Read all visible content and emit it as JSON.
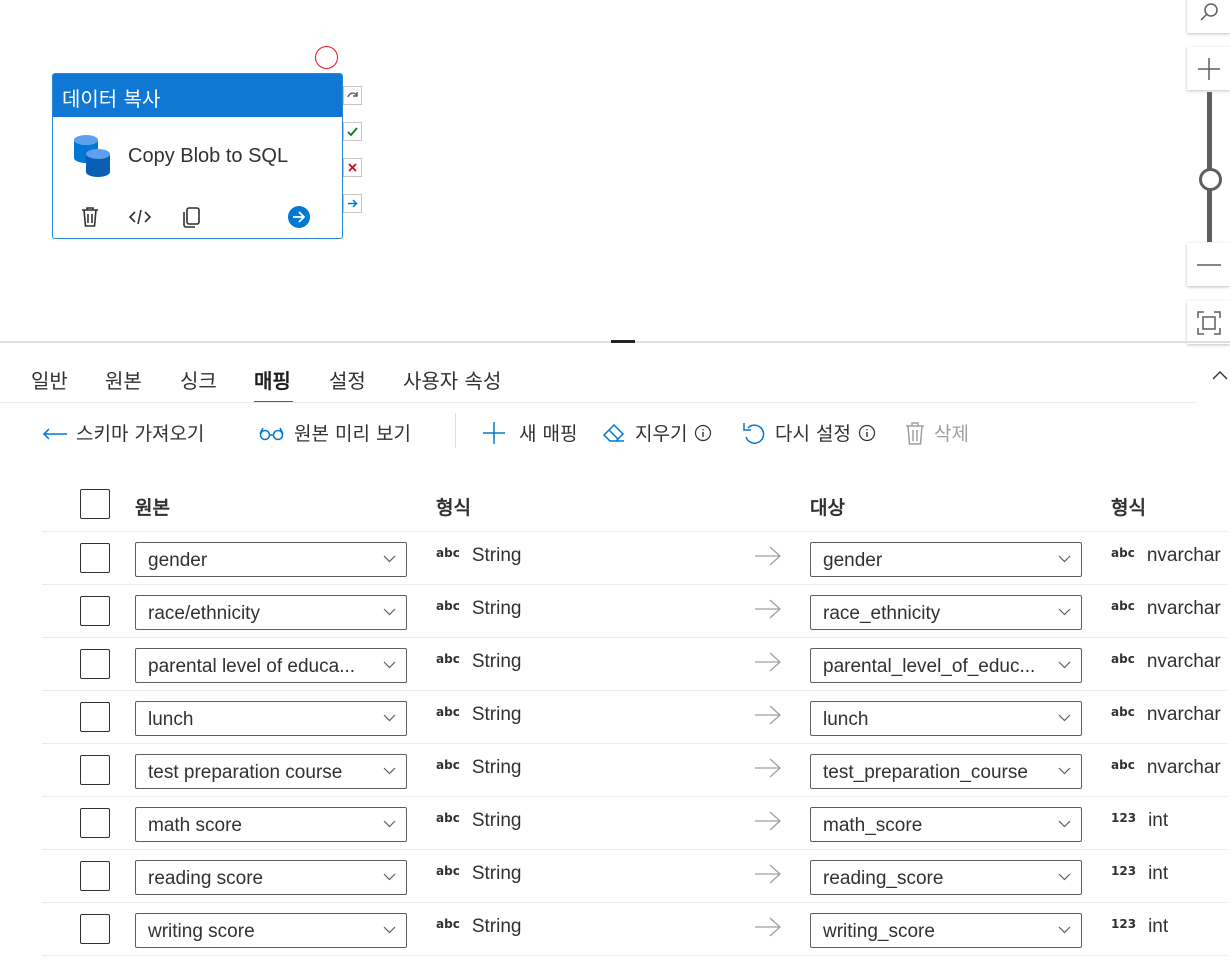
{
  "activity": {
    "header": "데이터 복사",
    "name": "Copy Blob to SQL"
  },
  "tabs": [
    "일반",
    "원본",
    "싱크",
    "매핑",
    "설정",
    "사용자 속성"
  ],
  "active_tab": "매핑",
  "toolbar": {
    "import_schema": "스키마 가져오기",
    "preview_source": "원본 미리 보기",
    "new_mapping": "새 매핑",
    "clear": "지우기",
    "reset": "다시 설정",
    "delete": "삭제"
  },
  "grid": {
    "headers": {
      "source": "원본",
      "source_type": "형식",
      "target": "대상",
      "target_type": "형식"
    },
    "rows": [
      {
        "source": "gender",
        "source_badge": "abc",
        "source_type": "String",
        "target": "gender",
        "target_badge": "abc",
        "target_type": "nvarchar"
      },
      {
        "source": "race/ethnicity",
        "source_badge": "abc",
        "source_type": "String",
        "target": "race_ethnicity",
        "target_badge": "abc",
        "target_type": "nvarchar"
      },
      {
        "source": "parental level of educa...",
        "source_badge": "abc",
        "source_type": "String",
        "target": "parental_level_of_educ...",
        "target_badge": "abc",
        "target_type": "nvarchar"
      },
      {
        "source": "lunch",
        "source_badge": "abc",
        "source_type": "String",
        "target": "lunch",
        "target_badge": "abc",
        "target_type": "nvarchar"
      },
      {
        "source": "test preparation course",
        "source_badge": "abc",
        "source_type": "String",
        "target": "test_preparation_course",
        "target_badge": "abc",
        "target_type": "nvarchar"
      },
      {
        "source": "math score",
        "source_badge": "abc",
        "source_type": "String",
        "target": "math_score",
        "target_badge": "123",
        "target_type": "int"
      },
      {
        "source": "reading score",
        "source_badge": "abc",
        "source_type": "String",
        "target": "reading_score",
        "target_badge": "123",
        "target_type": "int"
      },
      {
        "source": "writing score",
        "source_badge": "abc",
        "source_type": "String",
        "target": "writing_score",
        "target_badge": "123",
        "target_type": "int"
      }
    ]
  },
  "colors": {
    "accent": "#0078d4",
    "header_blue": "#0f78d4",
    "error_red": "#e81123",
    "success_green": "#107c10"
  }
}
